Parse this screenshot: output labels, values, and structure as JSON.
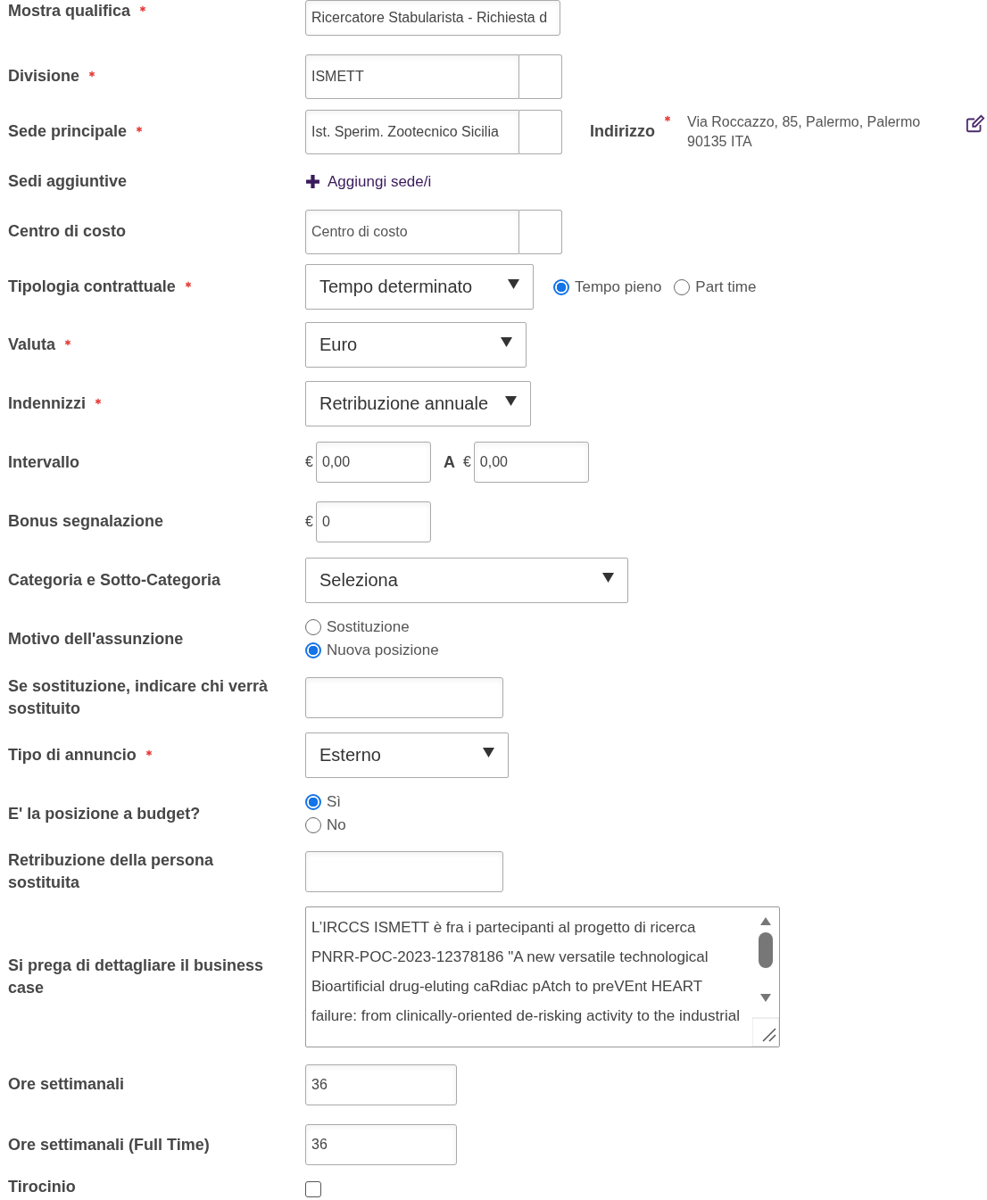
{
  "fields": [
    {
      "kind": "text",
      "label": "Mostra qualifica",
      "required": true,
      "value": "Ricercatore Stabularista - Richiesta d"
    },
    {
      "kind": "lookup",
      "label": "Divisione",
      "required": true,
      "value": "ISMETT"
    },
    {
      "kind": "lookup",
      "label": "Sede principale",
      "required": true,
      "value": "Ist. Sperim. Zootecnico Sicilia",
      "address": {
        "label": "Indirizzo",
        "required": true,
        "lines": [
          "Via Roccazzo, 85, Palermo, Palermo",
          "90135 ITA"
        ]
      }
    },
    {
      "kind": "link",
      "label": "Sedi aggiuntive",
      "required": false,
      "link": "Aggiungi sede/i"
    },
    {
      "kind": "lookup",
      "label": "Centro di costo",
      "required": false,
      "placeholder": "Centro di costo"
    },
    {
      "kind": "select",
      "label": "Tipologia contrattuale",
      "required": true,
      "value": "Tempo determinato",
      "options": [
        {
          "label": "Tempo pieno",
          "selected": true
        },
        {
          "label": "Part time",
          "selected": false
        }
      ]
    },
    {
      "kind": "select",
      "label": "Valuta",
      "required": true,
      "value": "Euro"
    },
    {
      "kind": "select",
      "label": "Indennizzi",
      "required": true,
      "value": "Retribuzione annuale"
    },
    {
      "kind": "range",
      "label": "Intervallo",
      "required": false,
      "currency": "€",
      "from": "0,00",
      "separator": "A",
      "to": "0,00"
    },
    {
      "kind": "money",
      "label": "Bonus segnalazione",
      "required": false,
      "currency": "€",
      "value": "0"
    },
    {
      "kind": "select",
      "label": "Categoria e Sotto-Categoria",
      "required": false,
      "value": "Seleziona"
    },
    {
      "kind": "radios",
      "label": "Motivo dell'assunzione",
      "required": false,
      "options": [
        {
          "label": "Sostituzione",
          "selected": false
        },
        {
          "label": "Nuova posizione",
          "selected": true
        }
      ]
    },
    {
      "kind": "text",
      "label": "Se sostituzione, indicare chi verrà sostituito",
      "required": false
    },
    {
      "kind": "select",
      "label": "Tipo di annuncio",
      "required": true,
      "value": "Esterno"
    },
    {
      "kind": "radios",
      "label": "E' la posizione a budget?",
      "required": false,
      "options": [
        {
          "label": "Sì",
          "selected": true
        },
        {
          "label": "No",
          "selected": false
        }
      ]
    },
    {
      "kind": "text",
      "label": "Retribuzione della persona sostituita",
      "required": false
    },
    {
      "kind": "textarea",
      "label": "Si prega di dettagliare il business case",
      "required": false,
      "value": "L’IRCCS ISMETT è fra i partecipanti al progetto di ricerca PNRR-POC-2023-12378186 \"A new versatile technological Bioartificial drug-eluting caRdiac pAtch to preVEnt HEART failure: from clinically-oriented de-risking activity to the industrial"
    },
    {
      "kind": "text",
      "label": "Ore settimanali",
      "required": false,
      "value": "36"
    },
    {
      "kind": "text",
      "label": "Ore settimanali (Full Time)",
      "required": false,
      "value": "36"
    },
    {
      "kind": "checkbox",
      "label": "Tirocinio",
      "required": false,
      "checked": false
    }
  ]
}
